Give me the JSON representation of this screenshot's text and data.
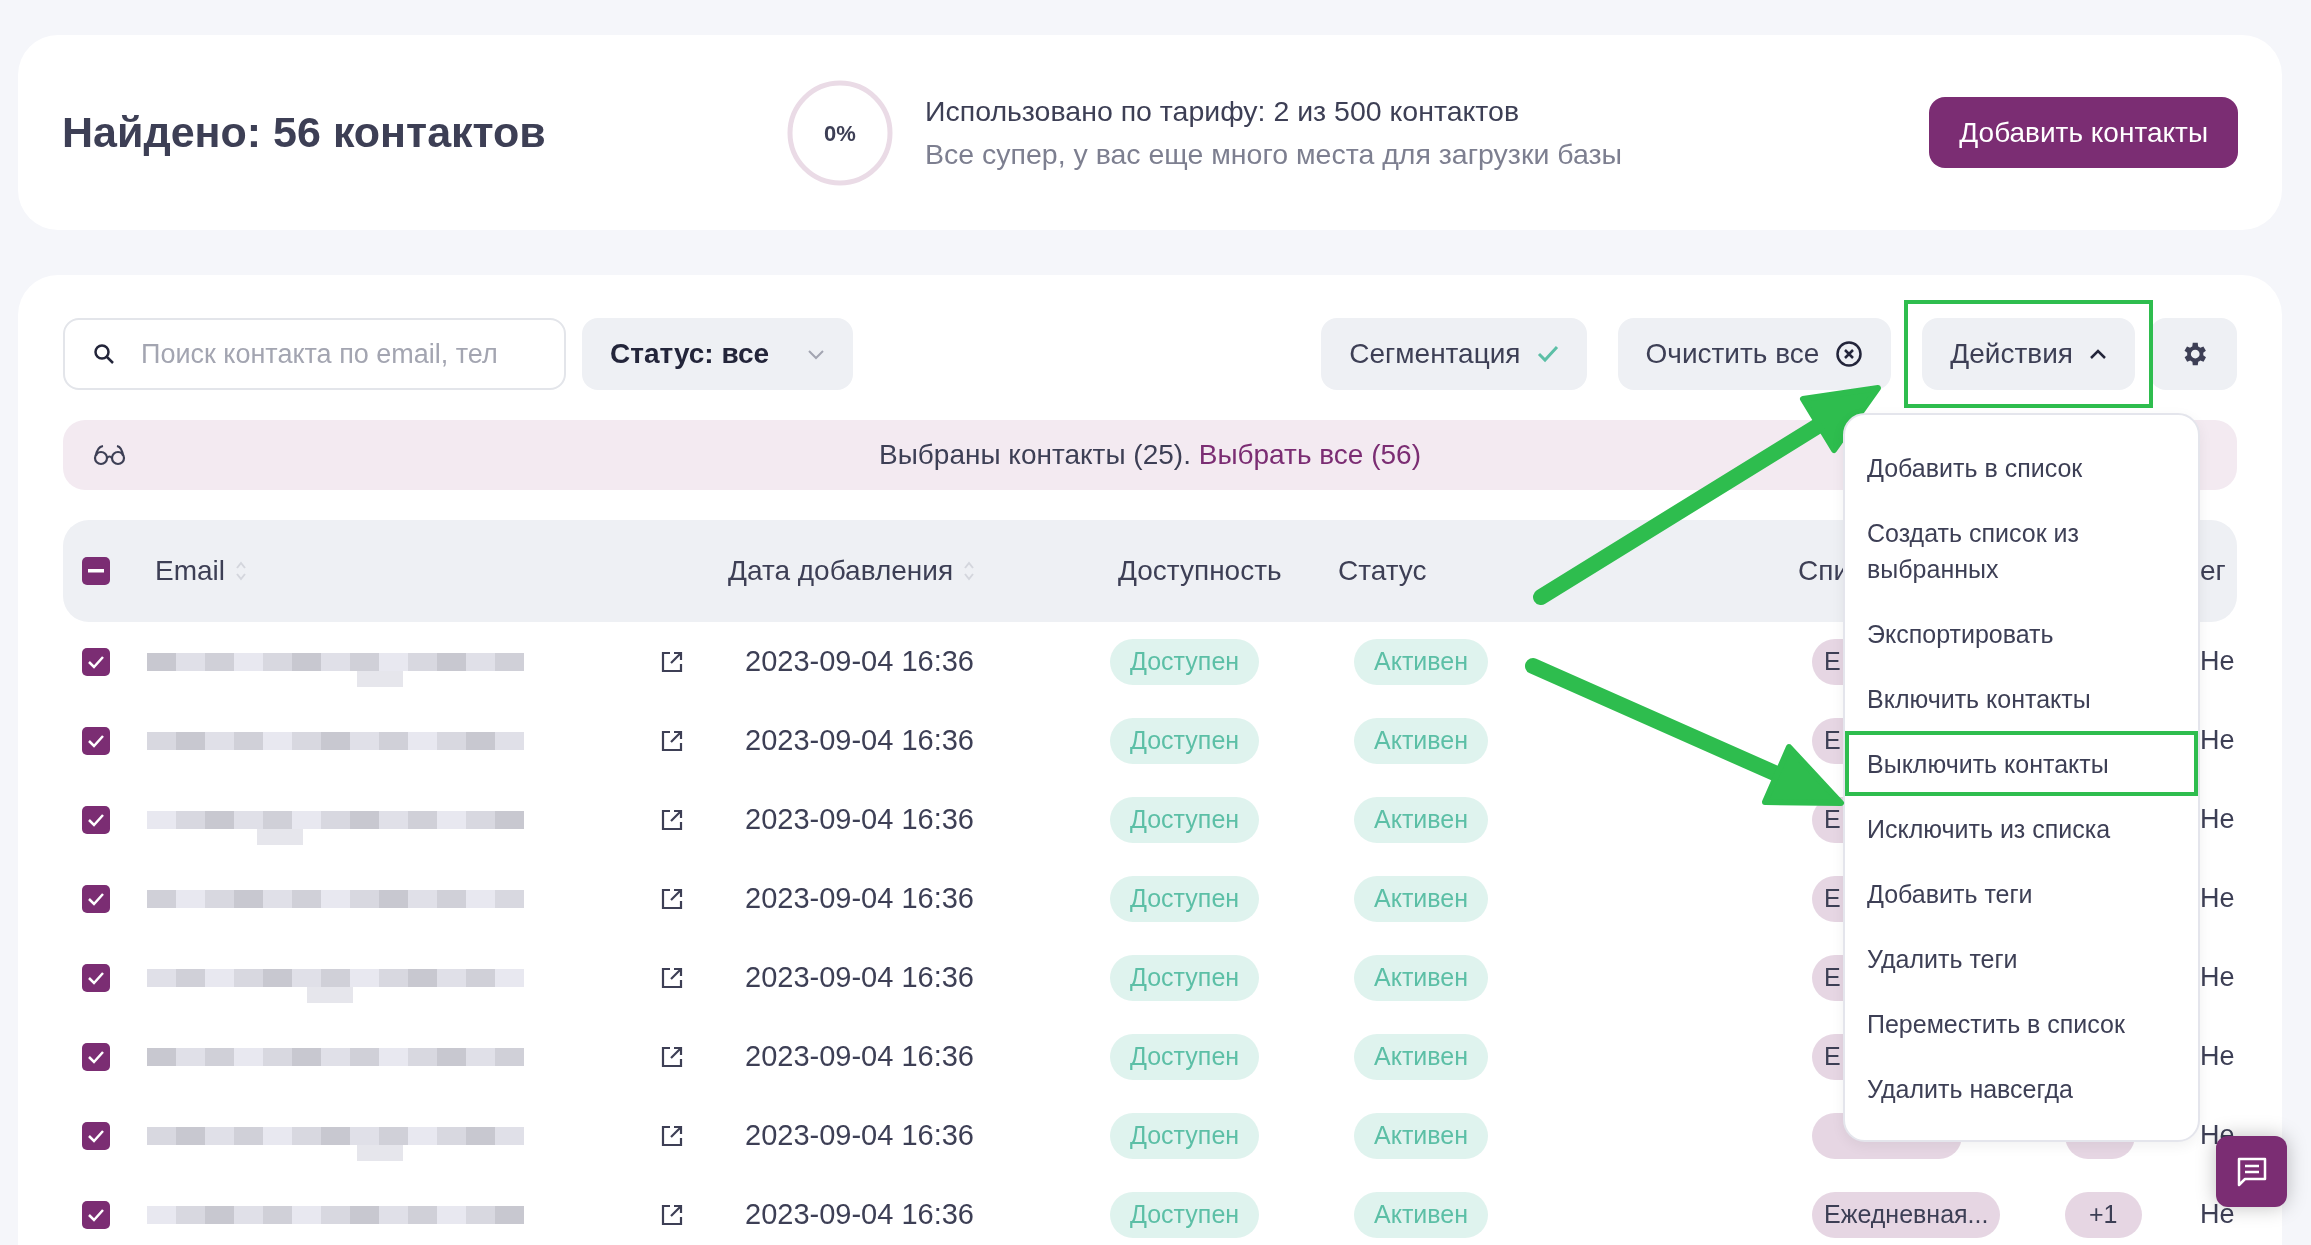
{
  "header": {
    "title": "Найдено: 56 контактов",
    "usage": {
      "percent": "0%",
      "line": "Использовано по тарифу: 2 из 500 контактов",
      "note": "Все супер, у вас еще много места для загрузки базы"
    },
    "add_button": "Добавить контакты"
  },
  "toolbar": {
    "search": {
      "placeholder": "Поиск контакта по email, тел"
    },
    "status_filter": "Статус: все",
    "segmentation": "Сегментация",
    "clear": "Очистить все",
    "actions": {
      "label": "Действия",
      "expanded": true,
      "callout": true
    }
  },
  "selection": {
    "text": "Выбраны контакты (25).",
    "link": "Выбрать все (56)"
  },
  "table": {
    "select_all": {
      "indeterminate": true
    },
    "columns": [
      {
        "label": "Email",
        "sortable": true
      },
      {
        "label": "Дата добавления",
        "sortable": true
      },
      {
        "label": "Доступность",
        "sortable": false
      },
      {
        "label": "Статус",
        "sortable": false
      },
      {
        "label": "Спи",
        "sortable": false
      },
      {
        "label": "ег",
        "sortable": false
      }
    ],
    "rows": [
      {
        "checked": true,
        "date": "2023-09-04 16:36",
        "availability": "Доступен",
        "status": "Активен",
        "list": "Е",
        "column_6": "Не"
      },
      {
        "checked": true,
        "date": "2023-09-04 16:36",
        "availability": "Доступен",
        "status": "Активен",
        "list": "Е",
        "column_6": "Не"
      },
      {
        "checked": true,
        "date": "2023-09-04 16:36",
        "availability": "Доступен",
        "status": "Активен",
        "list": "Е",
        "column_6": "Не"
      },
      {
        "checked": true,
        "date": "2023-09-04 16:36",
        "availability": "Доступен",
        "status": "Активен",
        "list": "Е",
        "column_6": "Не"
      },
      {
        "checked": true,
        "date": "2023-09-04 16:36",
        "availability": "Доступен",
        "status": "Активен",
        "list": "Е",
        "column_6": "Не"
      },
      {
        "checked": true,
        "date": "2023-09-04 16:36",
        "availability": "Доступен",
        "status": "Активен",
        "list": "Е",
        "column_6": "Не"
      },
      {
        "checked": true,
        "date": "2023-09-04 16:36",
        "availability": "Доступен",
        "status": "Активен",
        "list_badge": true,
        "extra_badge": true,
        "column_6": "Не"
      },
      {
        "checked": true,
        "date": "2023-09-04 16:36",
        "availability": "Доступен",
        "status": "Активен",
        "list": "Ежедневная...",
        "extra": "+1",
        "column_6": "Не"
      }
    ]
  },
  "menu": {
    "items": [
      {
        "label": "Добавить в список",
        "callout": false
      },
      {
        "label": "Создать список из выбранных",
        "callout": false
      },
      {
        "label": "Экспортировать",
        "callout": false
      },
      {
        "label": "Включить контакты",
        "callout": false
      },
      {
        "label": "Выключить контакты",
        "callout": true
      },
      {
        "label": "Исключить из списка",
        "callout": false
      },
      {
        "label": "Добавить теги",
        "callout": false
      },
      {
        "label": "Удалить теги",
        "callout": false
      },
      {
        "label": "Переместить в список",
        "callout": false
      },
      {
        "label": "Удалить навсегда",
        "callout": false
      }
    ]
  }
}
